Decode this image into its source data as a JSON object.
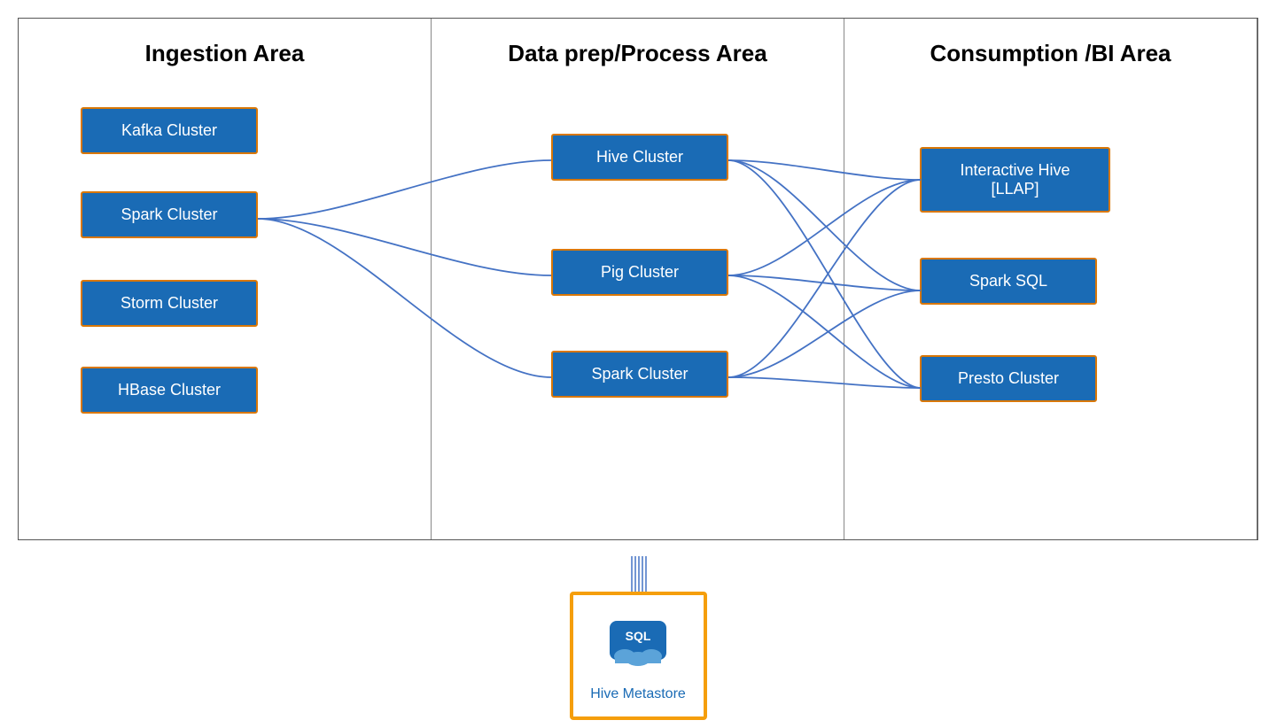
{
  "columns": [
    {
      "id": "ingestion",
      "title": "Ingestion Area",
      "boxes": [
        {
          "id": "kafka",
          "label": "Kafka Cluster"
        },
        {
          "id": "spark1",
          "label": "Spark Cluster"
        },
        {
          "id": "storm",
          "label": "Storm Cluster"
        },
        {
          "id": "hbase",
          "label": "HBase Cluster"
        }
      ]
    },
    {
      "id": "dataprep",
      "title": "Data prep/Process Area",
      "boxes": [
        {
          "id": "hive",
          "label": "Hive Cluster"
        },
        {
          "id": "pig",
          "label": "Pig Cluster"
        },
        {
          "id": "spark2",
          "label": "Spark Cluster"
        }
      ]
    },
    {
      "id": "consumption",
      "title": "Consumption /BI Area",
      "boxes": [
        {
          "id": "ihive",
          "label": "Interactive Hive [LLAP]"
        },
        {
          "id": "sparksql",
          "label": "Spark SQL"
        },
        {
          "id": "presto",
          "label": "Presto Cluster"
        }
      ]
    }
  ],
  "metastore": {
    "label": "Hive Metastore"
  }
}
